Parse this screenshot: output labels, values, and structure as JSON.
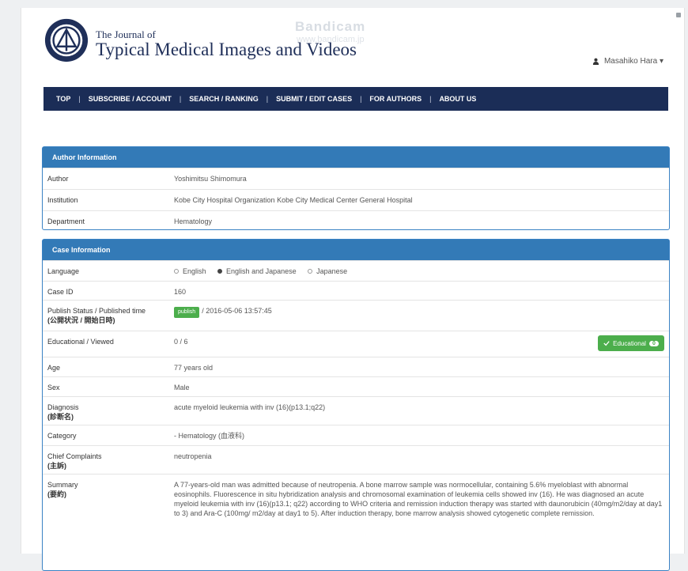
{
  "header": {
    "journal_small": "The Journal of",
    "journal_title": "Typical Medical Images and Videos",
    "watermark": "Bandicam",
    "watermark_sub": "www.bandicam.jp",
    "user_name": "Masahiko Hara ▾"
  },
  "nav": {
    "items": [
      "TOP",
      "SUBSCRIBE / ACCOUNT",
      "SEARCH / RANKING",
      "SUBMIT / EDIT CASES",
      "FOR AUTHORS",
      "ABOUT US"
    ],
    "separator": "|"
  },
  "author_panel": {
    "title": "Author Information",
    "rows": {
      "author_label": "Author",
      "author_value": "Yoshimitsu Shimomura",
      "institution_label": "Institution",
      "institution_value": "Kobe City Hospital Organization Kobe City Medical Center General Hospital",
      "department_label": "Department",
      "department_value": "Hematology"
    }
  },
  "case_panel": {
    "title": "Case Information",
    "language_label": "Language",
    "language_options": [
      "English",
      "English and Japanese",
      "Japanese"
    ],
    "case_id_label": "Case ID",
    "case_id_value": "160",
    "publish_label": "Publish Status / Published time",
    "publish_label_jp": "(公開状況 / 開始日時)",
    "publish_badge": "publish",
    "publish_time": "/ 2016-05-06 13:57:45",
    "educational_label": "Educational / Viewed",
    "educational_value": "0 / 6",
    "useful_label": "Educational",
    "useful_count": "0",
    "age_label": "Age",
    "age_value": "77 years old",
    "sex_label": "Sex",
    "sex_value": "Male",
    "diagnosis_label": "Diagnosis",
    "diagnosis_label_jp": "(診断名)",
    "diagnosis_value": "acute myeloid leukemia with inv (16)(p13.1;q22)",
    "category_label": "Category",
    "category_value": "- Hematology (血液科)",
    "complaint_label": "Chief Complaints",
    "complaint_label_jp": "(主訴)",
    "complaint_value": "neutropenia",
    "summary_label": "Summary",
    "summary_label_jp": "(要約)",
    "summary_value": "A 77-years-old man was admitted because of neutropenia. A bone marrow sample was normocellular, containing 5.6% myeloblast with abnormal eosinophils. Fluorescence in situ hybridization analysis and chromosomal examination of leukemia cells showed inv (16). He was diagnosed an acute myeloid leukemia with inv (16)(p13.1; q22) according to WHO criteria and remission induction therapy was started with daunorubicin (40mg/m2/day at day1 to 3) and Ara-C (100mg/ m2/day at day1 to 5). After induction therapy, bone marrow analysis showed cytogenetic complete remission."
  },
  "colors": {
    "nav_bg": "#1b2d57",
    "panel_head": "#337ab7",
    "success": "#4cae4c",
    "link": "#3a7ec2"
  }
}
